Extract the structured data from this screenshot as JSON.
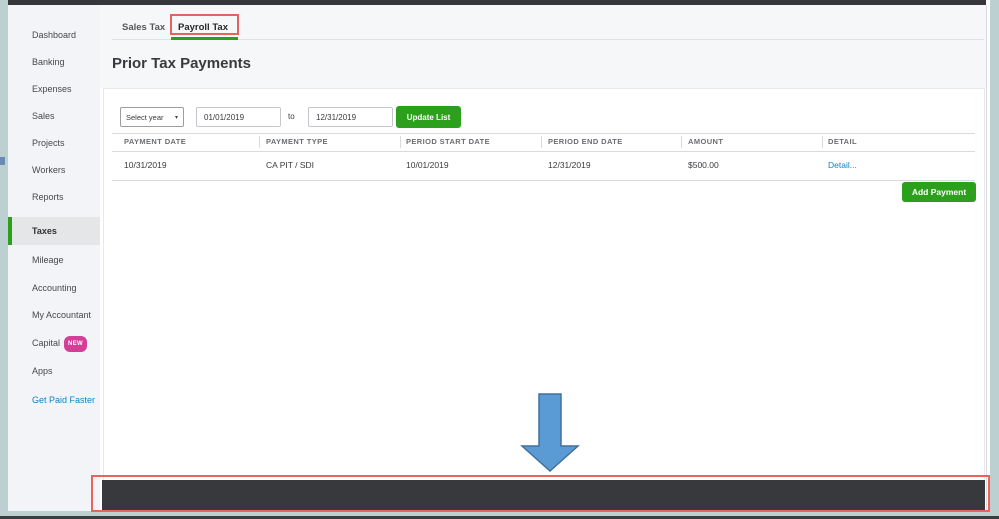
{
  "sidebar": {
    "items": [
      {
        "label": "Dashboard"
      },
      {
        "label": "Banking"
      },
      {
        "label": "Expenses"
      },
      {
        "label": "Sales"
      },
      {
        "label": "Projects"
      },
      {
        "label": "Workers"
      },
      {
        "label": "Reports"
      },
      {
        "label": "Taxes",
        "selected": true
      },
      {
        "label": "Mileage"
      },
      {
        "label": "Accounting"
      },
      {
        "label": "My Accountant"
      },
      {
        "label": "Capital",
        "badge": "NEW"
      },
      {
        "label": "Apps"
      },
      {
        "label": "Get Paid Faster"
      }
    ]
  },
  "tabs": {
    "items": [
      {
        "label": "Sales Tax"
      },
      {
        "label": "Payroll Tax",
        "active": true
      }
    ]
  },
  "main": {
    "title": "Prior Tax Payments",
    "add_payment_label": "Add Payment"
  },
  "filters": {
    "year_dropdown_value": "Select year",
    "start_date": "01/01/2019",
    "to_label": "to",
    "end_date": "12/31/2019",
    "update_button_label": "Update List"
  },
  "table": {
    "columns": [
      "PAYMENT DATE",
      "PAYMENT TYPE",
      "PERIOD START DATE",
      "PERIOD END DATE",
      "AMOUNT",
      "DETAIL"
    ],
    "rows": [
      {
        "payment_date": "10/31/2019",
        "payment_type": "CA PIT / SDI",
        "period_start_date": "10/01/2019",
        "period_end_date": "12/31/2019",
        "amount": "$500.00",
        "detail_link": "Detail..."
      }
    ]
  },
  "icons": {
    "year_dropdown_caret": "▾"
  },
  "colors": {
    "accent_green": "#2ca01c",
    "annotation_red": "#e9625e",
    "arrow_blue_fill": "#5b9bd5",
    "arrow_blue_stroke": "#41719c",
    "badge_pink": "#d33e97",
    "link_blue": "#0d83c6",
    "dark_bar": "#37393d",
    "frame_teal": "#bdd0d1"
  }
}
